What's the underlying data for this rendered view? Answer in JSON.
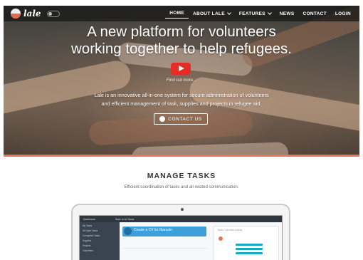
{
  "nav": {
    "logo_text": "lale",
    "items": [
      {
        "label": "HOME",
        "active": true,
        "dropdown": false
      },
      {
        "label": "ABOUT LALE",
        "active": false,
        "dropdown": true
      },
      {
        "label": "FEATURES",
        "active": false,
        "dropdown": true
      },
      {
        "label": "NEWS",
        "active": false,
        "dropdown": false
      },
      {
        "label": "CONTACT",
        "active": false,
        "dropdown": false
      },
      {
        "label": "LOGIN",
        "active": false,
        "dropdown": false
      }
    ]
  },
  "hero": {
    "headline_line1": "A new platform for volunteers",
    "headline_line2": "working together to help refugees.",
    "video_link": "Find out more...",
    "intro_line1": "Lale is an innovative all-in-one system for secure administration of volunteers",
    "intro_line2": "and efficient management of task, supplies and projects in refugee aid.",
    "contact_button": "CONTACT US",
    "accent_color": "#e8765a"
  },
  "tasks": {
    "title": "MANAGE TASKS",
    "subtitle": "Efficient coordination of tasks and all related communication."
  },
  "mockup": {
    "top_left": "Dashboard",
    "top_title": "Back to All Tasks",
    "sidebar_items": [
      "My Tasks",
      "All Open Tasks",
      "Completed Tasks",
      "Supplies",
      "Projects",
      "Volunteers"
    ],
    "card_title": "Create a CV for Manuim",
    "panel_title": "Tasks / Volunteer Activity"
  },
  "icons": {
    "play": "play-icon",
    "message": "message-icon",
    "chevron": "chevron-down-icon"
  }
}
